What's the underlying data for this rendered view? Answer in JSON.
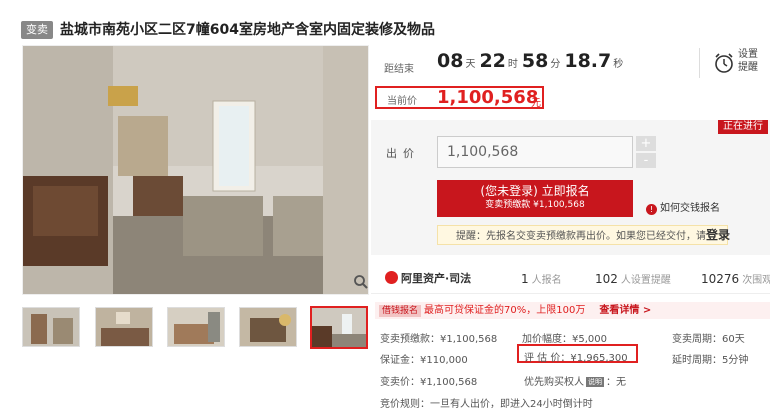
{
  "header": {
    "tag": "变卖",
    "title": "盐城市南苑小区二区7幢604室房地产含室内固定装修及物品"
  },
  "countdown": {
    "label": "距结束",
    "days": "08",
    "days_unit": "天",
    "hours": "22",
    "hours_unit": "时",
    "minutes": "58",
    "minutes_unit": "分",
    "seconds": "18.7",
    "seconds_unit": "秒"
  },
  "settings": {
    "label": "设置提醒",
    "icon": "alarm-clock-icon"
  },
  "current_price": {
    "label": "当前价",
    "value": "1,100,568",
    "unit": "元"
  },
  "status_badge": "正在进行",
  "bid": {
    "label": "出价",
    "input_value": "1,100,568",
    "plus": "+",
    "minus": "-",
    "signup_line1": "(您未登录) 立即报名",
    "signup_line2": "变卖预缴款 ¥1,100,568",
    "howto": "如何交钱报名",
    "reminder_text": "提醒：先报名交变卖预缴款再出价。如果您已经交付，请",
    "reminder_login": "登录"
  },
  "stats": {
    "brand": "阿里资产·司法",
    "signups_num": "1",
    "signups_label": "人报名",
    "reminders_num": "102",
    "reminders_label": "人设置提醒",
    "views_num": "10276",
    "views_label": "次围观"
  },
  "promo": {
    "pill": "借钱报名",
    "text": "最高可贷保证金的70%，上限100万",
    "more": "查看详情 >"
  },
  "details": {
    "prepay": "变卖预缴款：¥1,100,568",
    "increment": "加价幅度：¥5,000",
    "period": "变卖周期：60天",
    "deposit": "保证金：¥110,000",
    "evaluation": "评 估 价：¥1,965,300",
    "extension": "延时周期：5分钟",
    "sale_price": "变卖价：¥1,100,568",
    "priority_label": "优先购买权人",
    "priority_badge": "说明",
    "priority_value": "：无",
    "rule": "竞价规则：一旦有人出价，即进入24小时倒计时"
  },
  "colors": {
    "accent": "#e02020",
    "brand_red": "#c8161d"
  }
}
